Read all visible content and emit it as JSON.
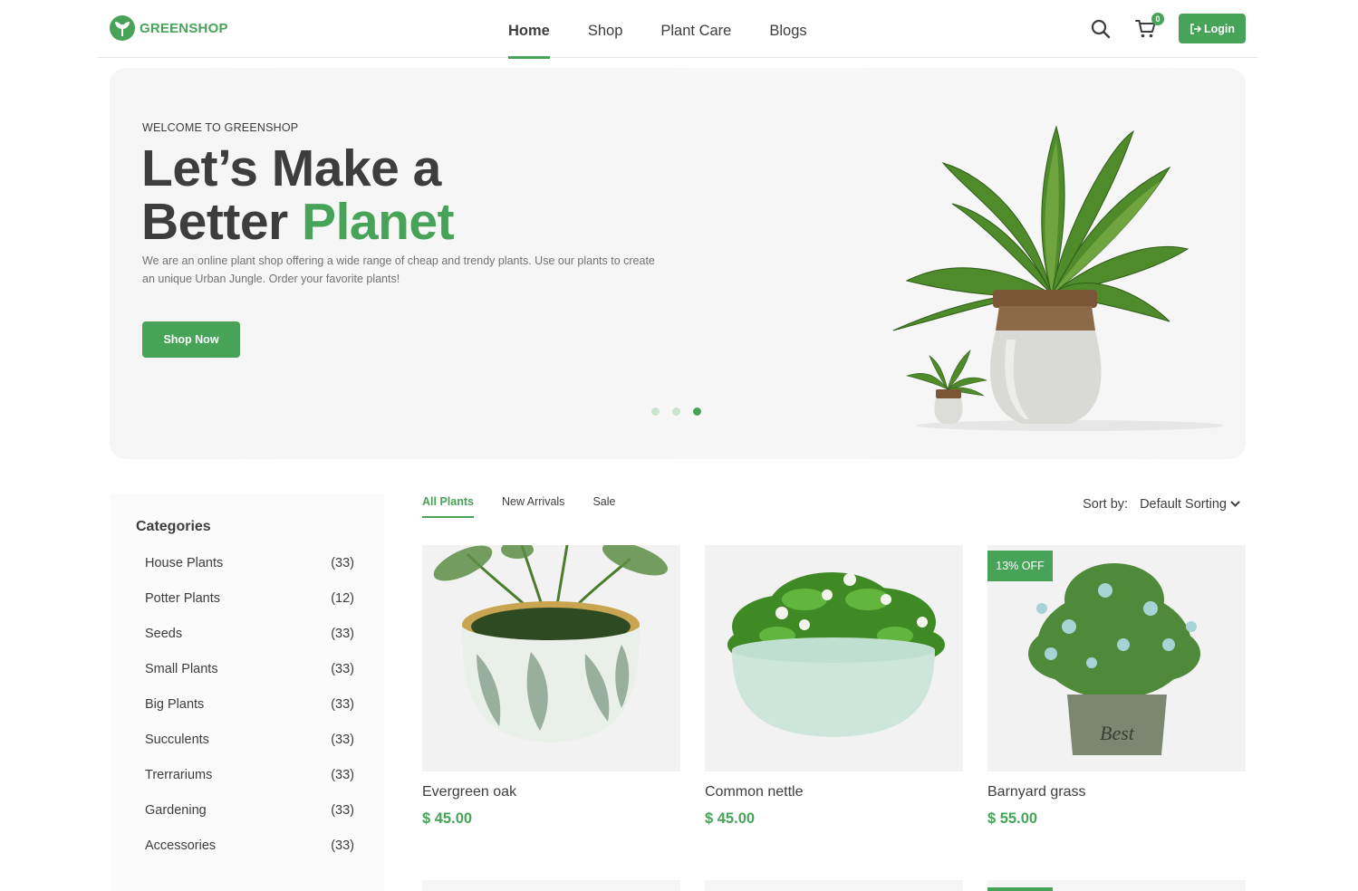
{
  "brand": {
    "name": "GREENSHOP",
    "color": "#46a358"
  },
  "nav": {
    "items": [
      {
        "label": "Home",
        "active": true
      },
      {
        "label": "Shop",
        "active": false
      },
      {
        "label": "Plant Care",
        "active": false
      },
      {
        "label": "Blogs",
        "active": false
      }
    ]
  },
  "header": {
    "search_icon": "search-icon",
    "cart_icon": "cart-icon",
    "cart_count": "0",
    "login_label": "Login",
    "login_icon": "login-icon"
  },
  "hero": {
    "kicker": "WELCOME TO GREENSHOP",
    "title_line1": "Let’s Make a",
    "title_line2_plain": "Better ",
    "title_line2_accent": "Planet",
    "description": "We are an online plant shop offering a wide range of cheap and trendy plants. Use our plants to create an unique Urban Jungle. Order your favorite plants!",
    "cta": "Shop Now",
    "slides": 3,
    "active_slide": 3
  },
  "sidebar": {
    "title": "Categories",
    "categories": [
      {
        "name": "House Plants",
        "count": "(33)"
      },
      {
        "name": "Potter Plants",
        "count": "(12)"
      },
      {
        "name": "Seeds",
        "count": "(33)"
      },
      {
        "name": "Small Plants",
        "count": "(33)"
      },
      {
        "name": "Big Plants",
        "count": "(33)"
      },
      {
        "name": "Succulents",
        "count": "(33)"
      },
      {
        "name": "Trerrariums",
        "count": "(33)"
      },
      {
        "name": "Gardening",
        "count": "(33)"
      },
      {
        "name": "Accessories",
        "count": "(33)"
      }
    ]
  },
  "tabs": [
    {
      "label": "All Plants",
      "active": true
    },
    {
      "label": "New Arrivals",
      "active": false
    },
    {
      "label": "Sale",
      "active": false
    }
  ],
  "sort": {
    "label": "Sort by:",
    "value": "Default Sorting"
  },
  "products": [
    {
      "name": "Evergreen oak",
      "price": "$ 45.00",
      "badge": ""
    },
    {
      "name": "Common nettle",
      "price": "$ 45.00",
      "badge": ""
    },
    {
      "name": "Barnyard grass",
      "price": "$ 55.00",
      "badge": "13% OFF"
    }
  ]
}
